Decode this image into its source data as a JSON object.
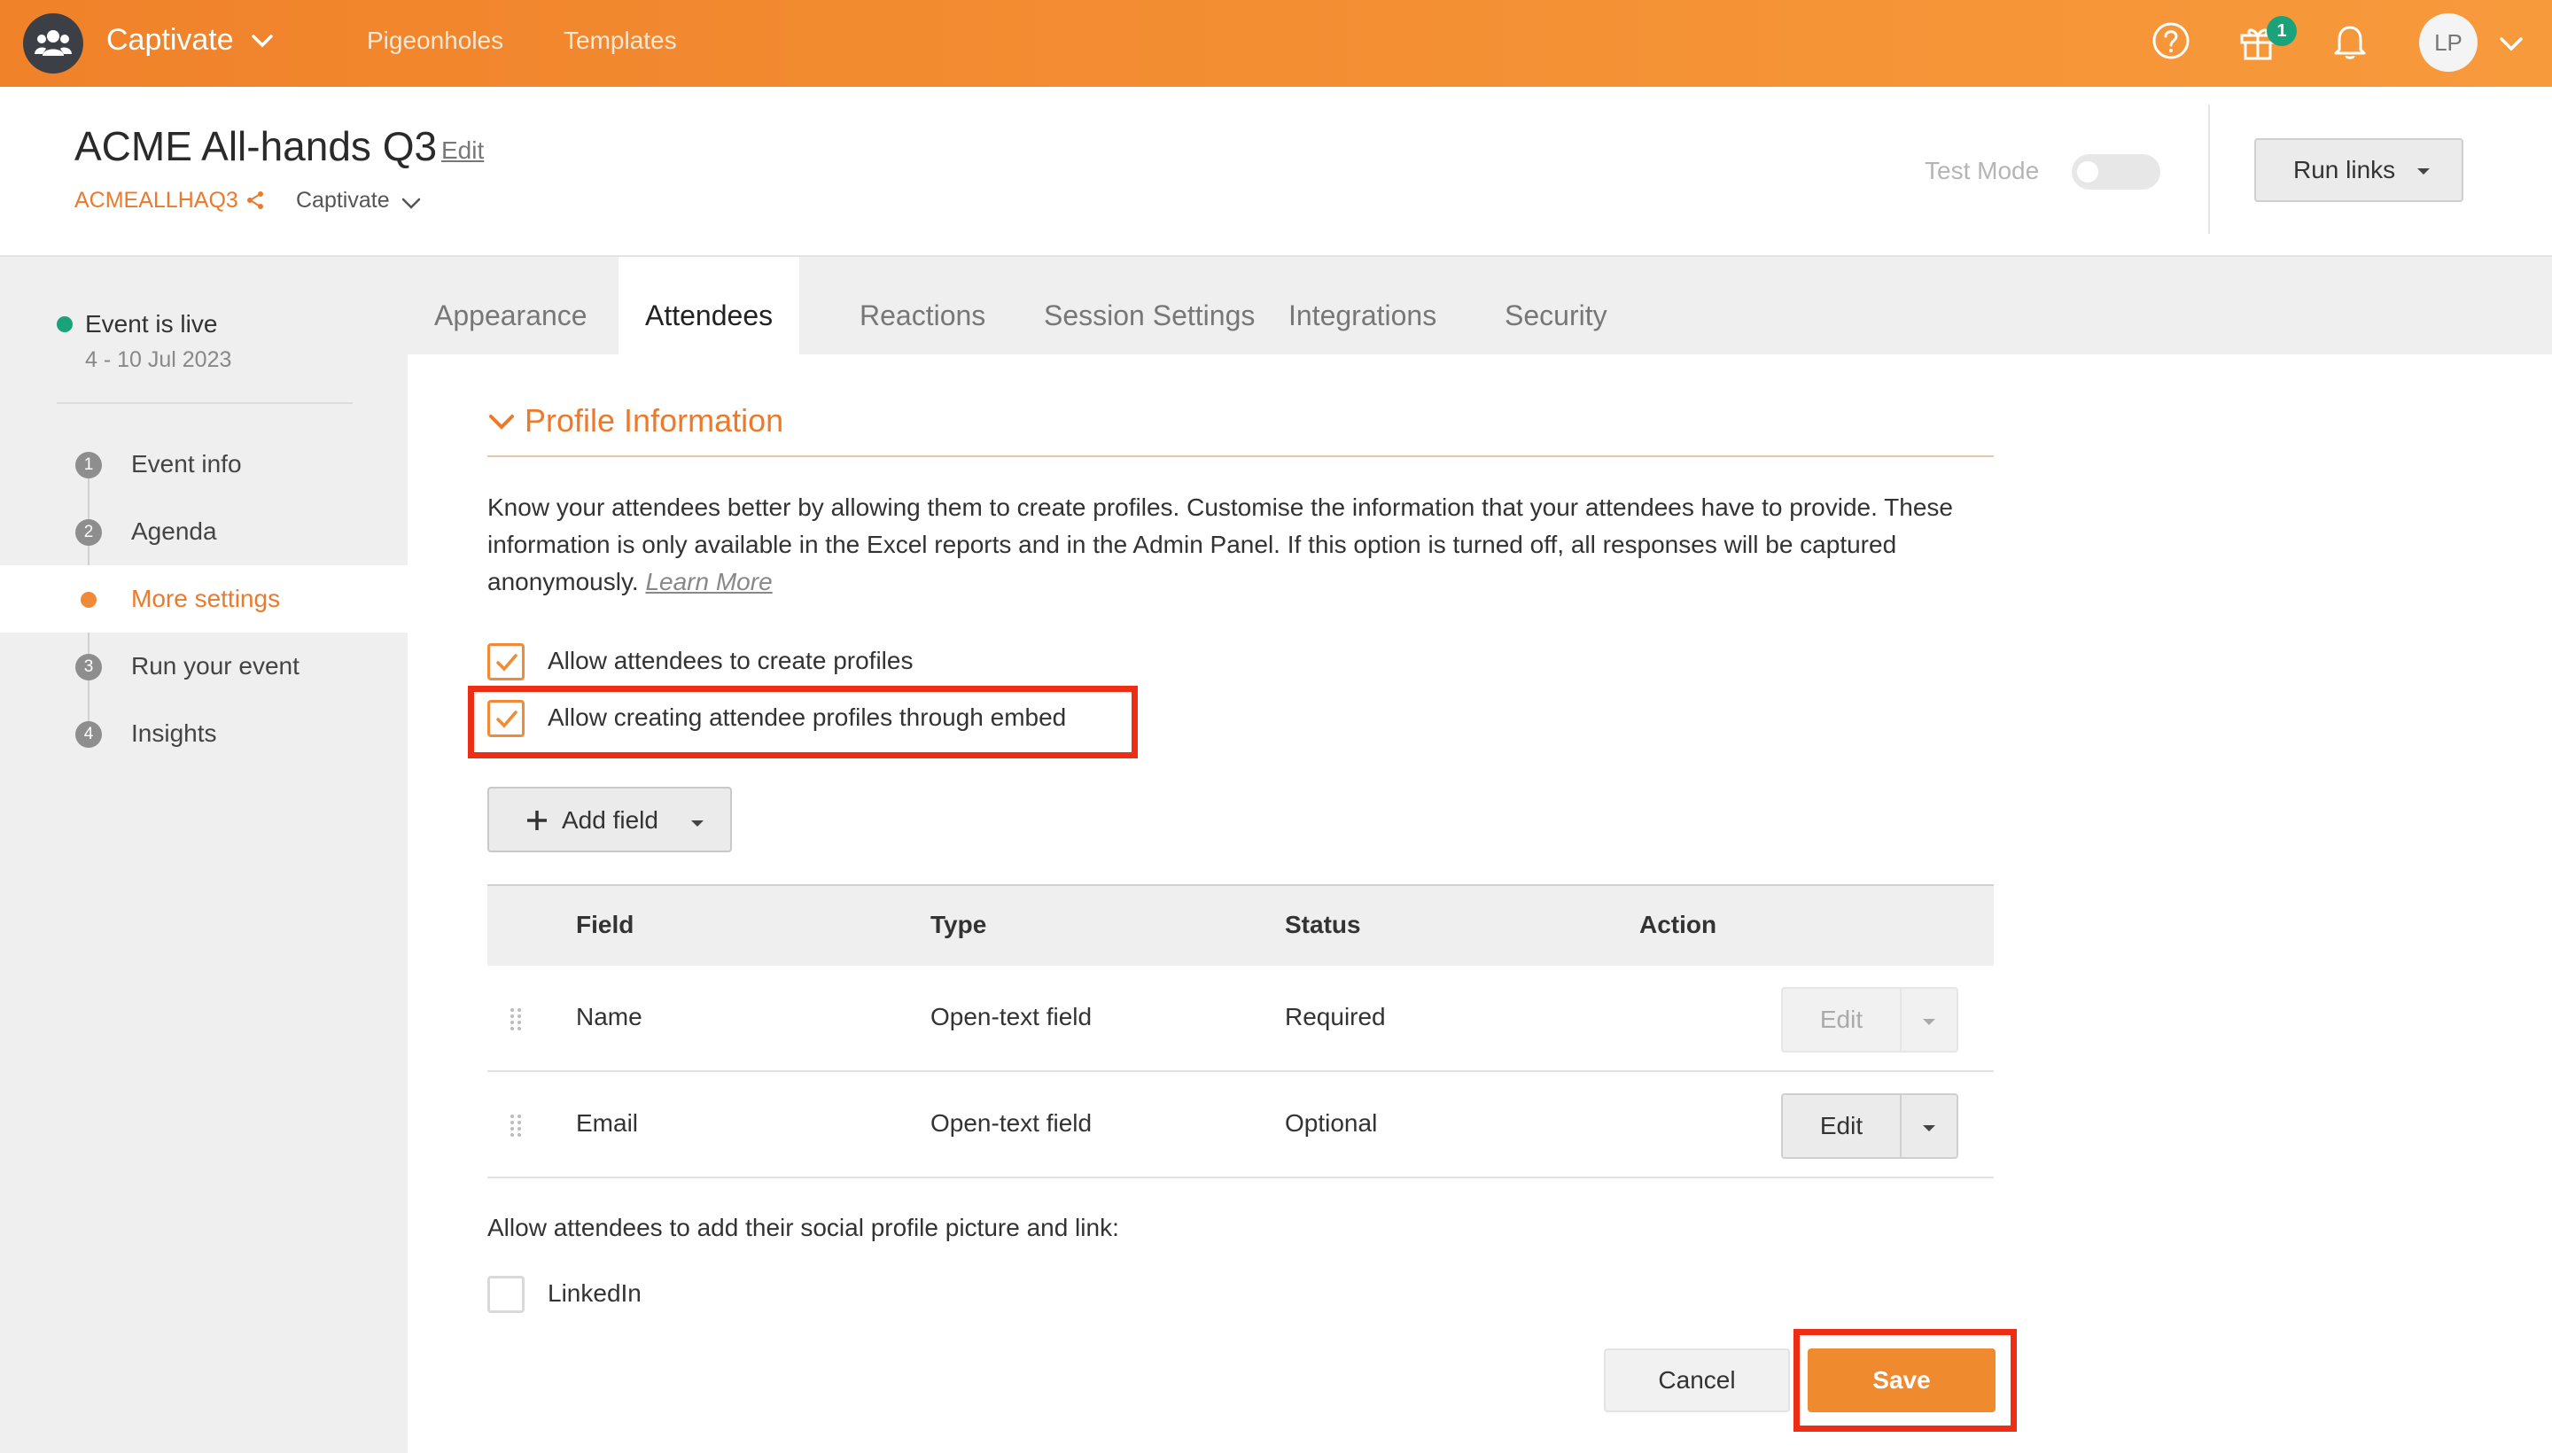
{
  "topbar": {
    "brand": "Captivate",
    "nav": [
      "Pigeonholes",
      "Templates"
    ],
    "gift_badge": "1",
    "avatar_initials": "LP"
  },
  "header": {
    "title": "ACME All-hands Q3",
    "edit_label": "Edit",
    "event_code": "ACMEALLHAQ3",
    "org": "Captivate",
    "test_mode_label": "Test Mode",
    "test_mode_on": false,
    "run_links_label": "Run links"
  },
  "sidebar": {
    "status": "Event is live",
    "dates": "4 - 10 Jul 2023",
    "items": [
      {
        "num": "1",
        "label": "Event info",
        "active": false
      },
      {
        "num": "2",
        "label": "Agenda",
        "active": false
      },
      {
        "num": "",
        "label": "More settings",
        "active": true
      },
      {
        "num": "3",
        "label": "Run your event",
        "active": false
      },
      {
        "num": "4",
        "label": "Insights",
        "active": false
      }
    ]
  },
  "tabs": [
    "Appearance",
    "Attendees",
    "Reactions",
    "Session Settings",
    "Integrations",
    "Security"
  ],
  "active_tab": "Attendees",
  "section": {
    "title": "Profile Information",
    "description": "Know your attendees better by allowing them to create profiles. Customise the information that your attendees have to provide. These information is only available in the Excel reports and in the Admin Panel. If this option is turned off, all responses will be captured anonymously.",
    "learn_more": "Learn More",
    "options": [
      {
        "label": "Allow attendees to create profiles",
        "checked": true
      },
      {
        "label": "Allow creating attendee profiles through embed",
        "checked": true
      }
    ],
    "add_field_label": "Add field"
  },
  "table": {
    "headers": [
      "Field",
      "Type",
      "Status",
      "Action"
    ],
    "rows": [
      {
        "field": "Name",
        "type": "Open-text field",
        "status": "Required",
        "action": "Edit",
        "disabled": true
      },
      {
        "field": "Email",
        "type": "Open-text field",
        "status": "Optional",
        "action": "Edit",
        "disabled": false
      }
    ]
  },
  "social": {
    "label": "Allow attendees to add their social profile picture and link:",
    "options": [
      {
        "label": "LinkedIn",
        "checked": false
      }
    ]
  },
  "footer": {
    "cancel": "Cancel",
    "save": "Save"
  },
  "colors": {
    "accent": "#f08a2e",
    "live": "#1aa37a",
    "highlight": "#ee2e14"
  }
}
